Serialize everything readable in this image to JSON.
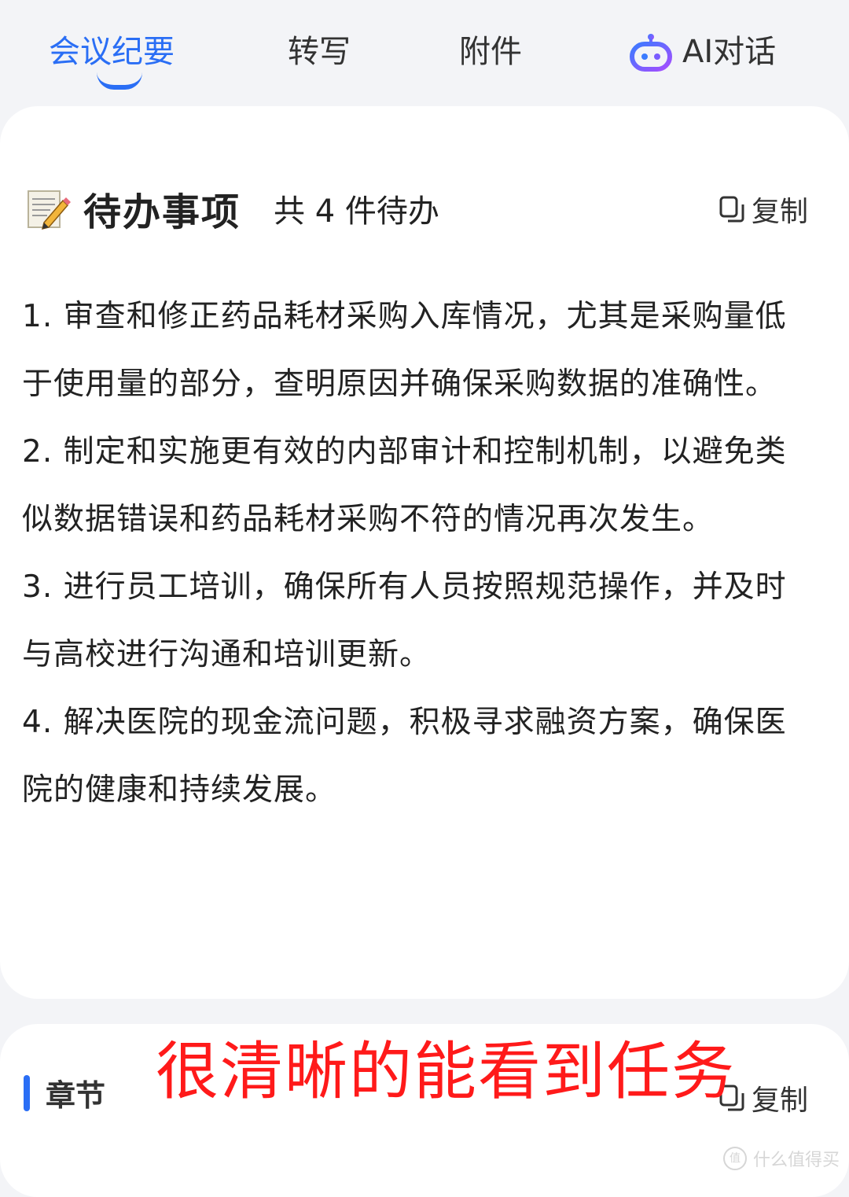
{
  "tabs": [
    {
      "label": "会议纪要",
      "active": true
    },
    {
      "label": "转写",
      "active": false
    },
    {
      "label": "附件",
      "active": false
    },
    {
      "label": "AI对话",
      "active": false
    }
  ],
  "todo": {
    "icon": "memo-icon",
    "title": "待办事项",
    "count_text": "共 4 件待办",
    "copy_label": "复制",
    "items": [
      "1. 审查和修正药品耗材采购入库情况，尤其是采购量低于使用量的部分，查明原因并确保采购数据的准确性。",
      "2. 制定和实施更有效的内部审计和控制机制，以避免类似数据错误和药品耗材采购不符的情况再次发生。",
      "3. 进行员工培训，确保所有人员按照规范操作，并及时与高校进行沟通和培训更新。",
      "4. 解决医院的现金流问题，积极寻求融资方案，确保医院的健康和持续发展。"
    ]
  },
  "chapter": {
    "title": "章节",
    "copy_label": "复制"
  },
  "overlay_caption": "很清晰的能看到任务",
  "watermark": "什么值得买",
  "colors": {
    "accent": "#2a6ef5",
    "caption": "#ff1a1a",
    "background": "#f3f4f7"
  }
}
